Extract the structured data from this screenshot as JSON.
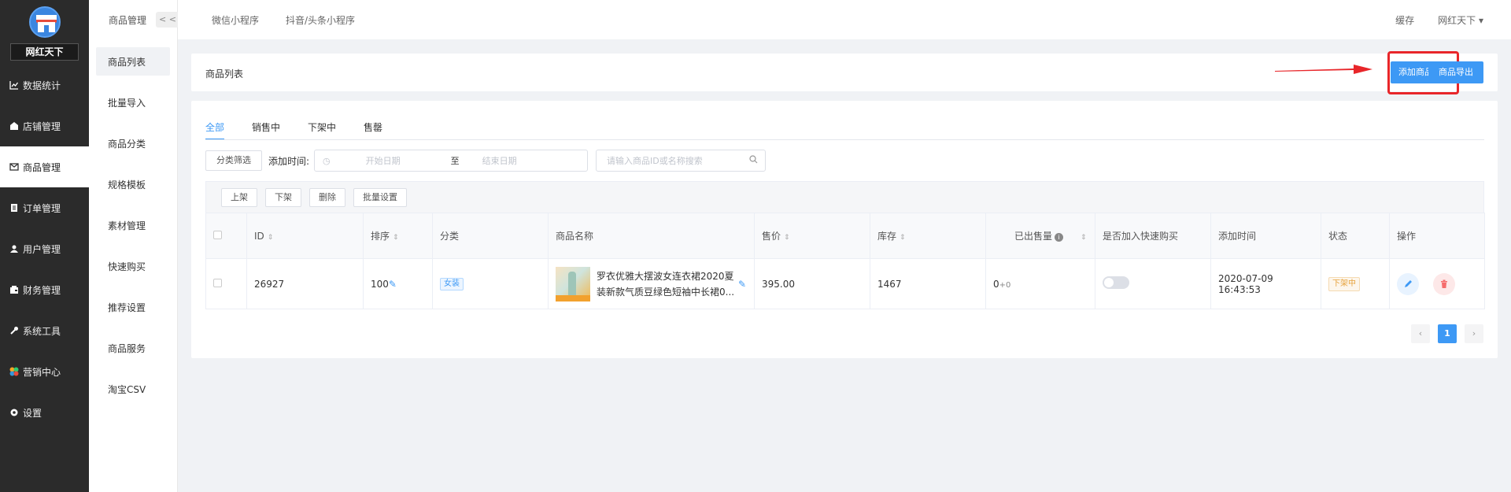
{
  "brand": {
    "name": "网红天下"
  },
  "main_menu": [
    {
      "label": "数据统计",
      "icon": "chart-icon"
    },
    {
      "label": "店铺管理",
      "icon": "store-icon"
    },
    {
      "label": "商品管理",
      "icon": "goods-icon",
      "active": true
    },
    {
      "label": "订单管理",
      "icon": "order-icon"
    },
    {
      "label": "用户管理",
      "icon": "user-icon"
    },
    {
      "label": "财务管理",
      "icon": "finance-icon"
    },
    {
      "label": "系统工具",
      "icon": "wrench-icon"
    },
    {
      "label": "营销中心",
      "icon": "marketing-icon"
    },
    {
      "label": "设置",
      "icon": "gear-icon"
    }
  ],
  "sub_menu": {
    "title": "商品管理",
    "collapse_label": "< <",
    "items": [
      "商品列表",
      "批量导入",
      "商品分类",
      "规格模板",
      "素材管理",
      "快速购买",
      "推荐设置",
      "商品服务",
      "淘宝CSV"
    ]
  },
  "topbar": {
    "tabs": [
      "微信小程序",
      "抖音/头条小程序"
    ],
    "cache_label": "缓存",
    "user_label": "网红天下 ▾"
  },
  "header": {
    "title": "商品列表",
    "add_button": "添加商品",
    "export_button": "商品导出"
  },
  "tabs": [
    "全部",
    "销售中",
    "下架中",
    "售罄"
  ],
  "filter": {
    "category_button": "分类筛选",
    "time_label": "添加时间:",
    "start_placeholder": "开始日期",
    "separator": "至",
    "end_placeholder": "结束日期",
    "search_placeholder": "请输入商品ID或名称搜索"
  },
  "toolbar": {
    "on_shelf": "上架",
    "off_shelf": "下架",
    "delete": "删除",
    "batch_settings": "批量设置"
  },
  "table": {
    "columns": [
      "ID",
      "排序",
      "分类",
      "商品名称",
      "售价",
      "库存",
      "已出售量",
      "是否加入快速购买",
      "添加时间",
      "状态",
      "操作"
    ],
    "rows": [
      {
        "id": "26927",
        "sort": "100",
        "category": "女装",
        "name": "罗衣优雅大摆波女连衣裙2020夏装新款气质豆绿色短袖中长裙0...",
        "price": "395.00",
        "stock": "1467",
        "sold_main": "0",
        "sold_extra": "+0",
        "quick_buy": false,
        "added": "2020-07-09 16:43:53",
        "status": "下架中"
      }
    ]
  },
  "pagination": {
    "current": "1",
    "prev": "‹",
    "next": "›"
  },
  "colors": {
    "primary": "#3d99f5",
    "highlight": "#e8262a",
    "sidebar": "#2b2b2b"
  }
}
